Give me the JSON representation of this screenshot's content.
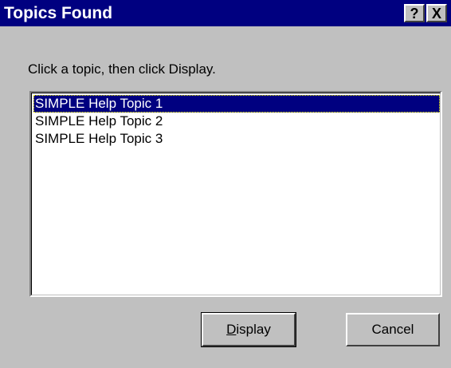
{
  "window": {
    "title": "Topics Found",
    "help_button": "?",
    "close_button": "X"
  },
  "prompt": "Click a topic, then click Display.",
  "topics": [
    {
      "label": "SIMPLE Help Topic 1",
      "selected": true
    },
    {
      "label": "SIMPLE Help Topic 2",
      "selected": false
    },
    {
      "label": "SIMPLE Help Topic 3",
      "selected": false
    }
  ],
  "buttons": {
    "display_mnemonic": "D",
    "display_rest": "isplay",
    "cancel": "Cancel"
  },
  "colors": {
    "titlebar": "#000080",
    "face": "#c0c0c0",
    "selection": "#000080"
  }
}
